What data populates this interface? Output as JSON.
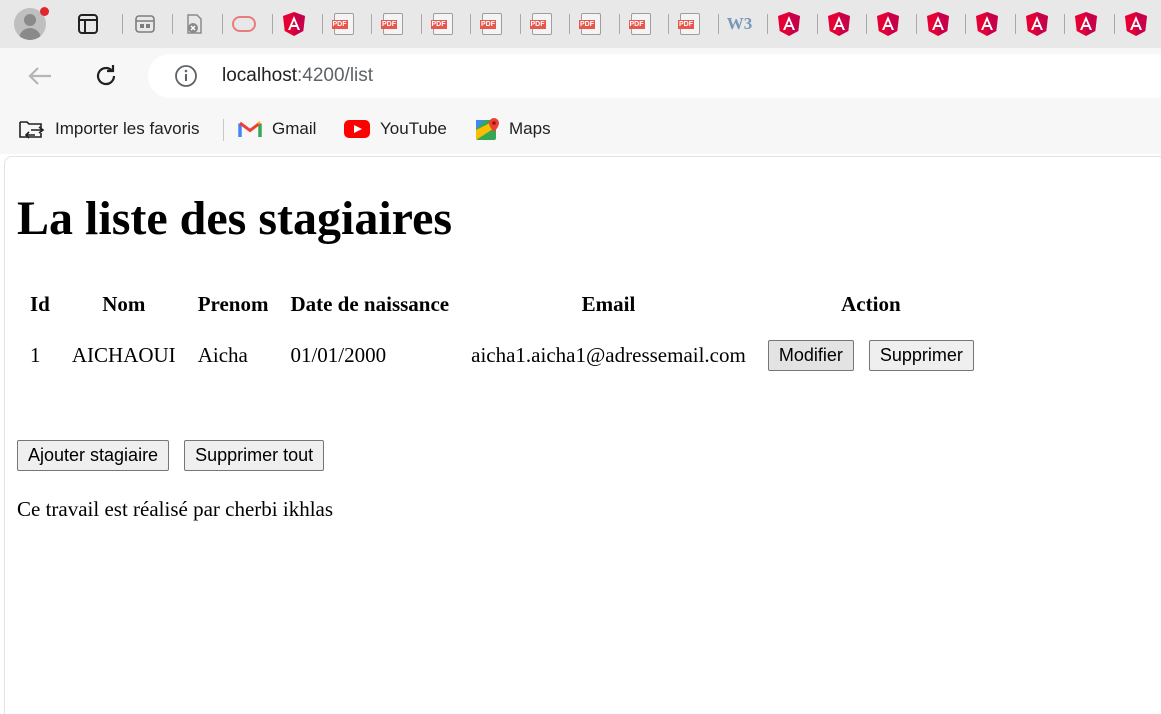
{
  "browser": {
    "address": {
      "host": "localhost",
      "path": ":4200/list"
    },
    "tabs": [
      {
        "icon": "sidebar-tab-icon"
      },
      {
        "icon": "tab-groups-icon"
      },
      {
        "icon": "closed-tab-icon"
      },
      {
        "icon": "opera-icon"
      },
      {
        "icon": "angular-icon"
      },
      {
        "icon": "pdf-icon",
        "label": "PDF"
      },
      {
        "icon": "pdf-icon",
        "label": "PDF"
      },
      {
        "icon": "pdf-icon",
        "label": "PDF"
      },
      {
        "icon": "pdf-icon",
        "label": "PDF"
      },
      {
        "icon": "pdf-icon",
        "label": "PDF"
      },
      {
        "icon": "pdf-icon",
        "label": "PDF"
      },
      {
        "icon": "pdf-icon",
        "label": "PDF"
      },
      {
        "icon": "pdf-icon",
        "label": "PDF"
      },
      {
        "icon": "w3schools-icon",
        "label": "W3"
      },
      {
        "icon": "angular-icon"
      },
      {
        "icon": "angular-icon"
      },
      {
        "icon": "angular-icon"
      },
      {
        "icon": "angular-icon"
      },
      {
        "icon": "angular-icon"
      },
      {
        "icon": "angular-icon"
      },
      {
        "icon": "angular-icon"
      },
      {
        "icon": "angular-icon"
      }
    ],
    "bookmarks": [
      {
        "label": "Importer les favoris",
        "icon": "import-bookmarks-icon"
      },
      {
        "label": "Gmail",
        "icon": "gmail-icon"
      },
      {
        "label": "YouTube",
        "icon": "youtube-icon"
      },
      {
        "label": "Maps",
        "icon": "maps-icon"
      }
    ]
  },
  "page": {
    "title": "La liste des stagiaires",
    "table": {
      "headers": [
        "Id",
        "Nom",
        "Prenom",
        "Date de naissance",
        "Email",
        "Action"
      ],
      "rows": [
        {
          "id": "1",
          "nom": "AICHAOUI",
          "prenom": "Aicha",
          "date": "01/01/2000",
          "email": "aicha1.aicha1@adressemail.com",
          "edit_label": "Modifier",
          "delete_label": "Supprimer"
        }
      ]
    },
    "add_label": "Ajouter stagiaire",
    "delete_all_label": "Supprimer tout",
    "footer": "Ce travail est réalisé par cherbi ikhlas"
  },
  "colors": {
    "angular": "#c3002f",
    "angular_gradient": "#e40035",
    "pdf": "#e8574d",
    "youtube": "#ff0000",
    "profile_badge": "#e3262e"
  }
}
